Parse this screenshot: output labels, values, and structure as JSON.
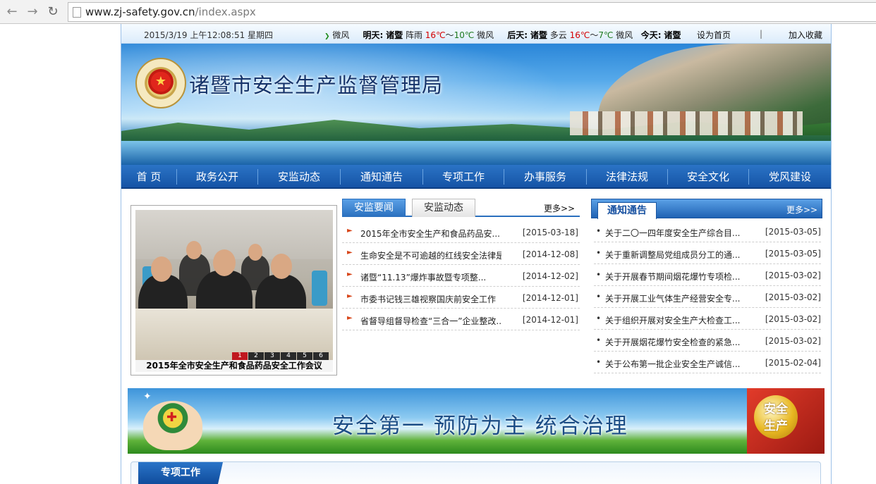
{
  "browser": {
    "url_host": "www.zj-safety.gov.cn",
    "url_path": "/index.aspx",
    "back_icon": "back-arrow-icon",
    "forward_icon": "forward-arrow-icon",
    "reload_icon": "reload-icon"
  },
  "topbar": {
    "datetime": "2015/3/19 上午12:08:51 星期四",
    "weather": {
      "today_wind": "微风",
      "tomorrow_label": "明天:",
      "tomorrow_place": "诸暨",
      "tomorrow_cond": "阵雨",
      "tomorrow_high": "16℃",
      "tomorrow_sep": "～",
      "tomorrow_low": "10℃",
      "tomorrow_wind": "微风",
      "after_label": "后天:",
      "after_place": "诸暨",
      "after_cond": "多云",
      "after_high": "16℃",
      "after_sep": "～",
      "after_low": "7℃",
      "after_wind": "微风",
      "today_label": "今天:",
      "today_place": "诸暨"
    },
    "set_home": "设为首页",
    "divider": "|",
    "add_fav": "加入收藏"
  },
  "site": {
    "title": "诸暨市安全生产监督管理局"
  },
  "nav": [
    {
      "label": "首  页"
    },
    {
      "label": "政务公开"
    },
    {
      "label": "安监动态"
    },
    {
      "label": "通知通告"
    },
    {
      "label": "专项工作"
    },
    {
      "label": "办事服务"
    },
    {
      "label": "法律法规"
    },
    {
      "label": "安全文化"
    },
    {
      "label": "党风建设"
    }
  ],
  "slideshow": {
    "caption": "2015年全市安全生产和食品药品安全工作会议",
    "pages": [
      "1",
      "2",
      "3",
      "4",
      "5",
      "6"
    ],
    "active_page": 1
  },
  "news_panel": {
    "tab_active": "安监要闻",
    "tab_inactive": "安监动态",
    "more": "更多>>",
    "items": [
      {
        "title": "2015年全市安全生产和食品药品安...",
        "date": "[2015-03-18]"
      },
      {
        "title": "生命安全是不可逾越的红线安全法律是...",
        "date": "[2014-12-08]"
      },
      {
        "title": "诸暨“11.13”爆炸事故暨专项整...",
        "date": "[2014-12-02]"
      },
      {
        "title": "市委书记钱三雄视察国庆前安全工作",
        "date": "[2014-12-01]"
      },
      {
        "title": "省督导组督导检查“三合一”企业整改...",
        "date": "[2014-12-01]"
      }
    ]
  },
  "notice_panel": {
    "tab": "通知通告",
    "more": "更多>>",
    "items": [
      {
        "title": "关于二〇一四年度安全生产综合目...",
        "date": "[2015-03-05]"
      },
      {
        "title": "关于重新调整局党组成员分工的通...",
        "date": "[2015-03-05]"
      },
      {
        "title": "关于开展春节期间烟花爆竹专项检...",
        "date": "[2015-03-02]"
      },
      {
        "title": "关于开展工业气体生产经营安全专...",
        "date": "[2015-03-02]"
      },
      {
        "title": "关于组织开展对安全生产大检查工...",
        "date": "[2015-03-02]"
      },
      {
        "title": "关于开展烟花爆竹安全检查的紧急...",
        "date": "[2015-03-02]"
      },
      {
        "title": "关于公布第一批企业安全生产诚信...",
        "date": "[2015-02-04]"
      }
    ]
  },
  "slogan": {
    "text": "安全第一  预防为主  统合治理",
    "badge_line1": "安全",
    "badge_line2": "生产"
  },
  "section": {
    "title": "专项工作"
  }
}
